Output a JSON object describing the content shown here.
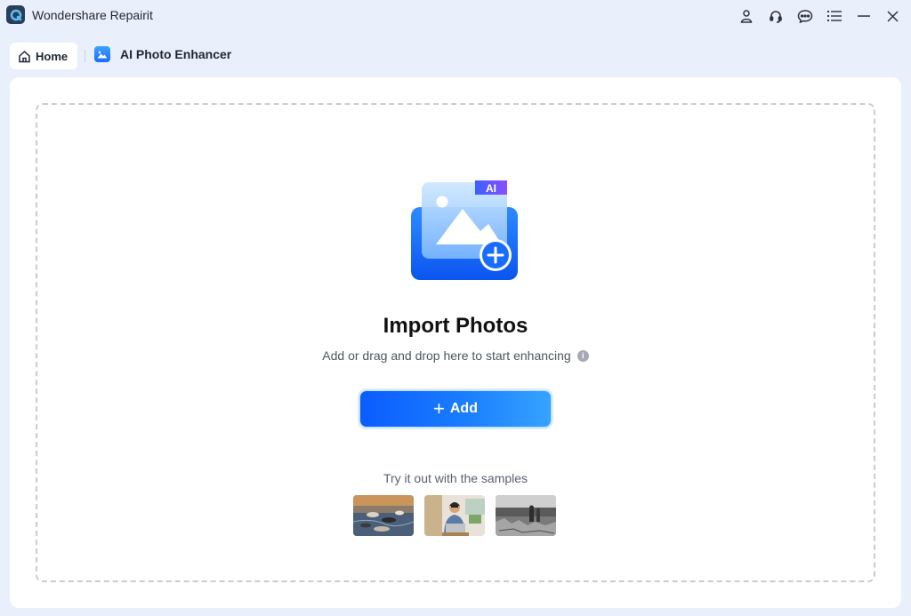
{
  "app": {
    "title": "Wondershare Repairit",
    "logo_icon": "repairit-logo-icon"
  },
  "titlebar": {
    "icons": [
      "user-icon",
      "headset-icon",
      "chat-icon",
      "menu-icon",
      "minimize-icon",
      "close-icon"
    ]
  },
  "tabs": {
    "home_label": "Home",
    "feature_label": "AI Photo Enhancer"
  },
  "main": {
    "ai_badge": "AI",
    "title": "Import Photos",
    "subtitle": "Add or drag and drop here to start enhancing",
    "add_button": {
      "plus": "+",
      "label": "Add"
    },
    "samples_label": "Try it out with the samples",
    "samples": [
      "sample-photo-lake-birds",
      "sample-photo-man-laptop",
      "sample-photo-bw-street"
    ]
  },
  "colors": {
    "accent": "#1a6cff",
    "background": "#e9f0fb",
    "panel": "#ffffff"
  }
}
